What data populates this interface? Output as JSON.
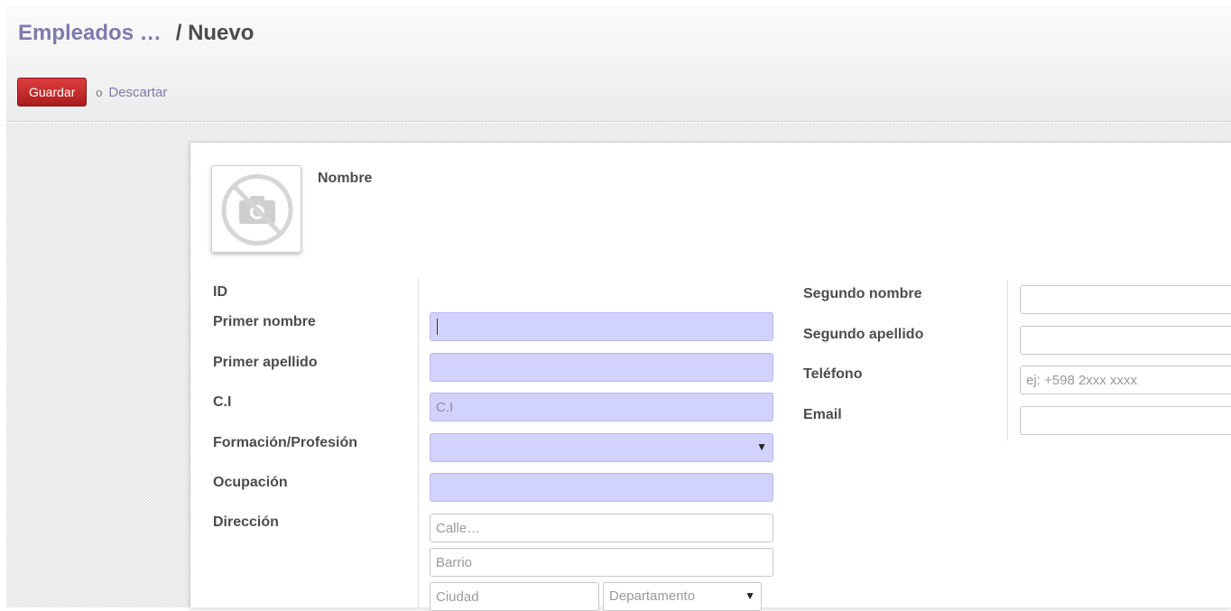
{
  "header": {
    "breadcrumb_parent": "Empleados …",
    "breadcrumb_separator": "/",
    "breadcrumb_current": "Nuevo",
    "save_label": "Guardar",
    "or_label": "o",
    "discard_label": "Descartar"
  },
  "form": {
    "name_label": "Nombre",
    "left_labels": {
      "id": "ID",
      "first_name": "Primer nombre",
      "first_surname": "Primer apellido",
      "ci": "C.I",
      "profession": "Formación/Profesión",
      "occupation": "Ocupación",
      "address": "Dirección"
    },
    "left_fields": {
      "first_name_value": "",
      "first_surname_value": "",
      "ci_placeholder": "C.I",
      "profession_value": "",
      "occupation_value": "",
      "street_placeholder": "Calle…",
      "neighborhood_placeholder": "Barrio",
      "city_placeholder": "Ciudad",
      "department_placeholder": "Departamento"
    },
    "right_labels": {
      "second_name": "Segundo nombre",
      "second_surname": "Segundo apellido",
      "phone": "Teléfono",
      "email": "Email"
    },
    "right_fields": {
      "second_name_value": "",
      "second_surname_value": "",
      "phone_placeholder": "ej: +598 2xxx xxxx",
      "email_value": ""
    }
  },
  "colors": {
    "link": "#7c7bad",
    "required_field": "#d2d2ff",
    "save_button": "#c42b2b"
  },
  "icons": {
    "photo_placeholder": "no-camera-icon",
    "dropdown": "dropdown-arrow-icon"
  }
}
